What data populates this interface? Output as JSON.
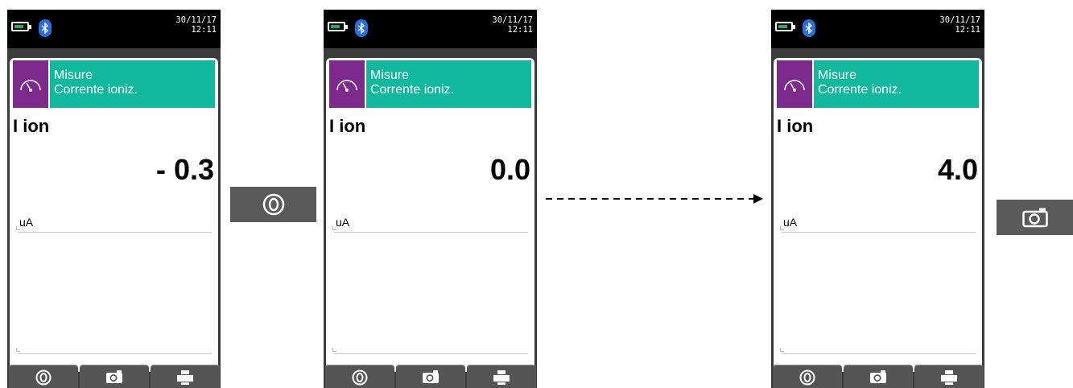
{
  "screens": [
    {
      "status": {
        "date": "30/11/17",
        "time": "12:11",
        "battery_level": 0.7
      },
      "header": {
        "title_line1": "Misure",
        "title_line2": "Corrente ioniz."
      },
      "measurement": {
        "name": "I ion",
        "value": "- 0.3",
        "unit": "uA"
      },
      "tabs": [
        "zero-icon",
        "camera-icon",
        "printer-icon"
      ]
    },
    {
      "status": {
        "date": "30/11/17",
        "time": "12:11",
        "battery_level": 0.7
      },
      "header": {
        "title_line1": "Misure",
        "title_line2": "Corrente ioniz."
      },
      "measurement": {
        "name": "I ion",
        "value": "0.0",
        "unit": "uA"
      },
      "tabs": [
        "zero-icon",
        "camera-icon",
        "printer-icon"
      ]
    },
    {
      "status": {
        "date": "30/11/17",
        "time": "12:11",
        "battery_level": 0.7
      },
      "header": {
        "title_line1": "Misure",
        "title_line2": "Corrente ioniz."
      },
      "measurement": {
        "name": "I ion",
        "value": "4.0",
        "unit": "uA"
      },
      "tabs": [
        "zero-icon",
        "camera-icon",
        "printer-icon"
      ]
    }
  ],
  "side_buttons": [
    {
      "icon": "zero-icon"
    },
    {
      "icon": "camera-icon"
    }
  ],
  "colors": {
    "header_green": "#12b89d",
    "icon_purple": "#7c2b8c",
    "bluetooth_blue": "#2a6fe0",
    "battery_green": "#22b14c"
  }
}
